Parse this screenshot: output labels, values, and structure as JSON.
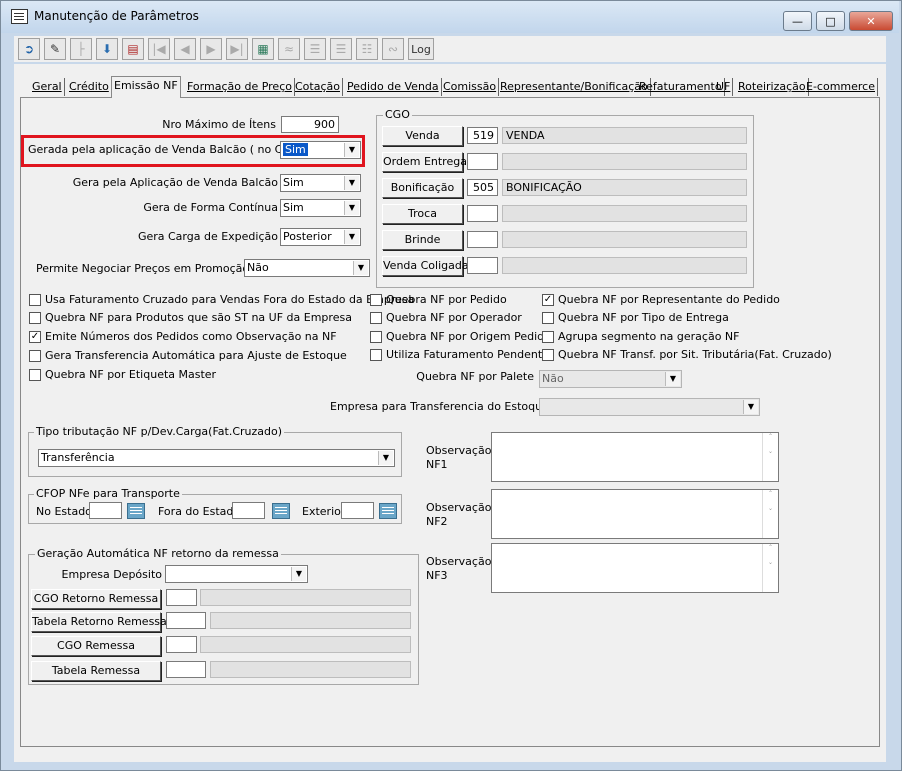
{
  "window": {
    "title": "Manutenção de Parâmetros"
  },
  "toolbar": {
    "log_label": "Log"
  },
  "tabs": [
    "Geral",
    "Crédito",
    "Emissão NF",
    "Formação de Preço",
    "Cotação",
    "Pedido de Venda",
    "Comissão",
    "Representante/Bonificação",
    "Refaturamento",
    "UF",
    "Roteirização",
    "E-commerce"
  ],
  "params": {
    "nro_max_itens_label": "Nro Máximo de Ítens",
    "nro_max_itens_value": "900",
    "gerada_balcao_label": "Gerada pela aplicação de Venda Balcão ( no Caixa )",
    "gerada_balcao_value": "Sim",
    "gera_balcao_label": "Gera pela Aplicação de Venda Balcão",
    "gera_balcao_value": "Sim",
    "forma_continua_label": "Gera de Forma Contínua",
    "forma_continua_value": "Sim",
    "carga_expedicao_label": "Gera Carga de Expedição",
    "carga_expedicao_value": "Posterior",
    "negociar_precos_label": "Permite Negociar Preços em Promoção",
    "negociar_precos_value": "Não"
  },
  "cgo": {
    "title": "CGO",
    "rows": [
      {
        "label": "Venda",
        "code": "519",
        "desc": "VENDA"
      },
      {
        "label": "Ordem Entrega",
        "code": "",
        "desc": ""
      },
      {
        "label": "Bonificação",
        "code": "505",
        "desc": "BONIFICAÇÃO"
      },
      {
        "label": "Troca",
        "code": "",
        "desc": ""
      },
      {
        "label": "Brinde",
        "code": "",
        "desc": ""
      },
      {
        "label": "Venda Coligada",
        "code": "",
        "desc": ""
      }
    ]
  },
  "checkboxes": {
    "col1": [
      {
        "label": "Usa Faturamento Cruzado para Vendas Fora do Estado da Empresa",
        "checked": false
      },
      {
        "label": "Quebra NF para Produtos que são ST na UF da Empresa",
        "checked": false
      },
      {
        "label": "Emite Números dos Pedidos como Observação na NF",
        "checked": true
      },
      {
        "label": "Gera Transferencia Automática para Ajuste de Estoque",
        "checked": false
      },
      {
        "label": "Quebra NF por Etiqueta Master",
        "checked": false
      }
    ],
    "col2": [
      {
        "label": "Quebra NF por Pedido",
        "checked": false
      },
      {
        "label": "Quebra NF por Operador",
        "checked": false
      },
      {
        "label": "Quebra NF por Origem Pedido",
        "checked": false
      },
      {
        "label": "Utiliza Faturamento Pendente",
        "checked": false
      }
    ],
    "col3": [
      {
        "label": "Quebra NF por Representante do Pedido",
        "checked": true
      },
      {
        "label": "Quebra NF por Tipo de Entrega",
        "checked": false
      },
      {
        "label": "Agrupa segmento na geração NF",
        "checked": false
      },
      {
        "label": "Quebra NF Transf. por Sit. Tributária(Fat. Cruzado)",
        "checked": false
      }
    ]
  },
  "quebra_palete": {
    "label": "Quebra NF por Palete",
    "value": "Não"
  },
  "empresa_transf": {
    "label": "Empresa para Transferencia do Estoque",
    "value": ""
  },
  "tipo_tributacao": {
    "title": "Tipo tributação NF p/Dev.Carga(Fat.Cruzado)",
    "value": "Transferência"
  },
  "cfop": {
    "title": "CFOP NFe para Transporte",
    "no_estado": "No Estado",
    "fora_estado": "Fora do Estado",
    "exterior": "Exterior"
  },
  "retorno": {
    "title": "Geração Automática NF retorno da remessa",
    "empresa_label": "Empresa Depósito",
    "buttons": [
      "CGO Retorno Remessa",
      "Tabela Retorno Remessa",
      "CGO Remessa",
      "Tabela Remessa"
    ]
  },
  "observacoes": [
    {
      "label1": "Observação",
      "label2": "NF1"
    },
    {
      "label1": "Observação",
      "label2": "NF2"
    },
    {
      "label1": "Observação",
      "label2": "NF3"
    }
  ]
}
